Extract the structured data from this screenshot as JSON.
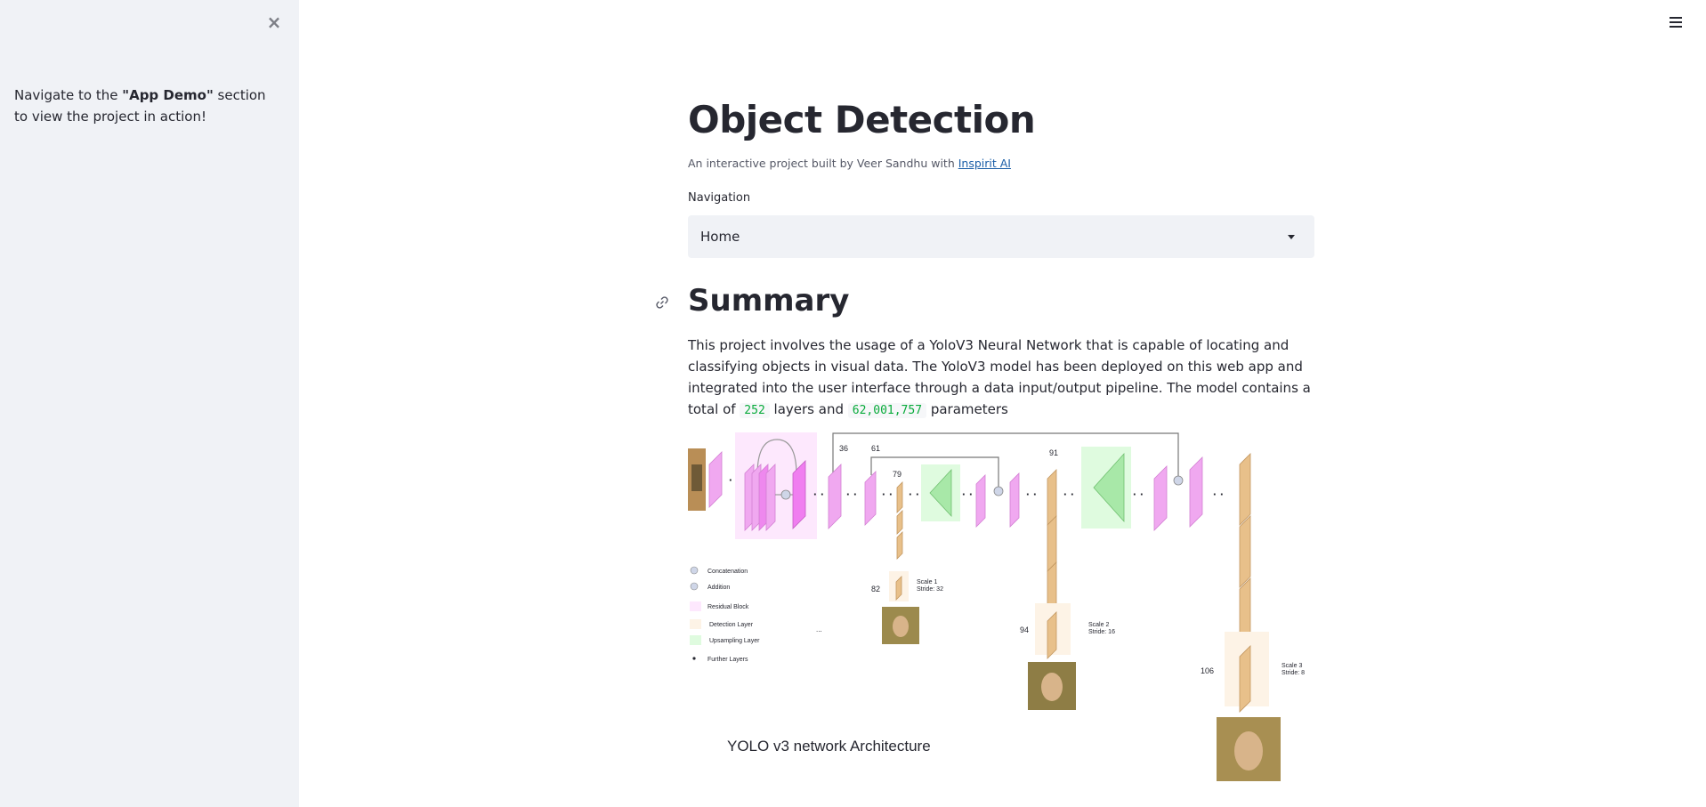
{
  "sidebar": {
    "close_label": "×",
    "text_before": "Navigate to the ",
    "text_bold": "\"App Demo\"",
    "text_after": " section to view the project in action!"
  },
  "header": {
    "menu_icon": "hamburger-menu-icon"
  },
  "main": {
    "title": "Object Detection",
    "subtitle_prefix": "An interactive project built by Veer Sandhu with ",
    "subtitle_link": "Inspirit AI",
    "nav_label": "Navigation",
    "nav_selected": "Home",
    "summary_heading": "Summary",
    "summary_part1": "This project involves the usage of a YoloV3 Neural Network that is capable of locating and classifying objects in visual data. The YoloV3 model has been deployed on this web app and integrated into the user interface through a data input/output pipeline. The model contains a total of ",
    "layers_count": "252",
    "summary_part2": " layers and ",
    "params_count": "62,001,757",
    "summary_part3": " parameters"
  },
  "figure": {
    "caption": "YOLO v3 network Architecture",
    "layer_labels": [
      "36",
      "61",
      "79",
      "91",
      "82",
      "94",
      "106"
    ],
    "legend": [
      "Concatenation",
      "Addition",
      "Residual Block",
      "Detection Layer",
      "Upsampling Layer",
      "Further Layers"
    ],
    "scale1": [
      "Scale 1",
      "Stride: 32"
    ],
    "scale2": [
      "Scale 2",
      "Stride: 16"
    ],
    "scale3": [
      "Scale 3",
      "Stride: 8"
    ],
    "colors": {
      "residual": "#f0a8f0",
      "detection": "#e8c08a",
      "upsampling": "#a8e8a8",
      "accent": "#ff4b4b"
    }
  }
}
